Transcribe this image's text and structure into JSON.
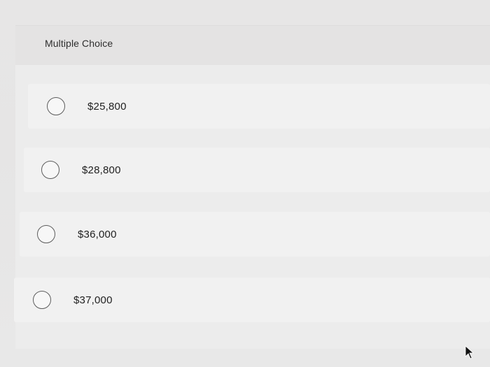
{
  "question": {
    "type_label": "Multiple Choice"
  },
  "options": [
    {
      "label": "$25,800",
      "selected": false
    },
    {
      "label": "$28,800",
      "selected": false
    },
    {
      "label": "$36,000",
      "selected": false
    },
    {
      "label": "$37,000",
      "selected": false
    }
  ],
  "colors": {
    "radio_border": "#5d5d5d",
    "text": "#1f1f1f",
    "row_background": "#f1f1f1"
  },
  "icons": {
    "cursor": "mouse-pointer-icon"
  }
}
